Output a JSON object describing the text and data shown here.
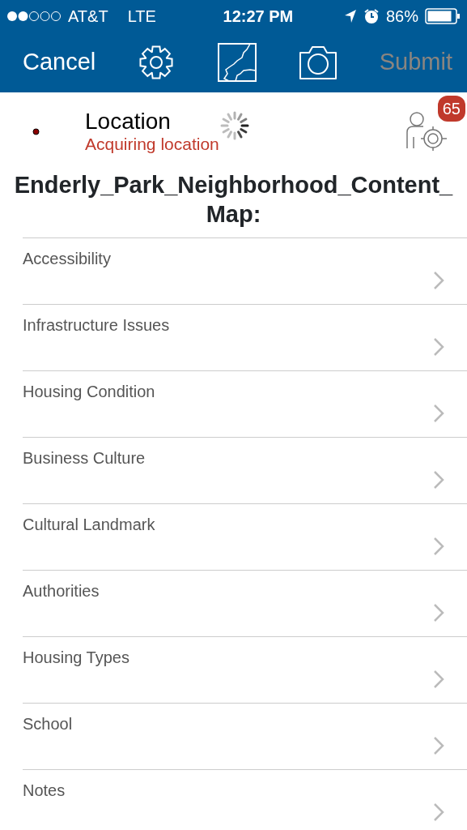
{
  "status_bar": {
    "carrier": "AT&T",
    "network": "LTE",
    "time": "12:27 PM",
    "battery": "86%"
  },
  "toolbar": {
    "cancel": "Cancel",
    "submit": {
      "label": "Submit",
      "disabled": true
    }
  },
  "location": {
    "label": "Location",
    "status": "Acquiring location",
    "badge": "65"
  },
  "title": "Enderly_Park_Neighborhood_Content_Map:",
  "items": [
    {
      "label": "Accessibility"
    },
    {
      "label": "Infrastructure Issues"
    },
    {
      "label": "Housing Condition"
    },
    {
      "label": "Business Culture"
    },
    {
      "label": "Cultural Landmark"
    },
    {
      "label": "Authorities"
    },
    {
      "label": "Housing Types"
    },
    {
      "label": "School"
    },
    {
      "label": "Notes"
    }
  ]
}
